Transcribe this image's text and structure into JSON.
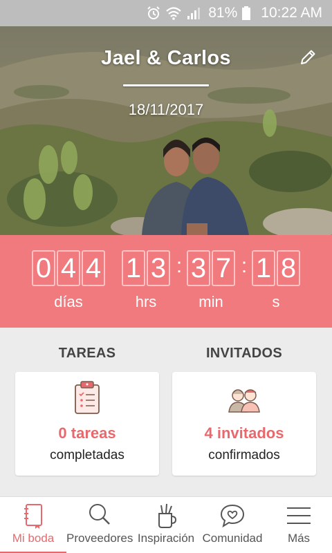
{
  "status_bar": {
    "battery": "81%",
    "time": "10:22 AM",
    "icons": [
      "alarm-icon",
      "wifi-icon",
      "signal-icon",
      "battery-icon"
    ]
  },
  "hero": {
    "title": "Jael & Carlos",
    "date": "18/11/2017",
    "edit_icon": "pencil-icon"
  },
  "countdown": {
    "days": [
      "0",
      "4",
      "4"
    ],
    "hours": [
      "1",
      "3"
    ],
    "minutes": [
      "3",
      "7"
    ],
    "seconds": [
      "1",
      "8"
    ],
    "labels": {
      "days": "días",
      "hours": "hrs",
      "minutes": "min",
      "seconds": "s"
    }
  },
  "sections": {
    "tasks": {
      "heading": "TAREAS",
      "count": "0 tareas",
      "sub": "completadas",
      "icon": "clipboard-icon"
    },
    "guests": {
      "heading": "INVITADOS",
      "count": "4 invitados",
      "sub": "confirmados",
      "icon": "guests-icon"
    }
  },
  "bottom_nav": [
    {
      "label": "Mi boda",
      "icon": "notebook-icon",
      "active": true
    },
    {
      "label": "Proveedores",
      "icon": "search-icon",
      "active": false
    },
    {
      "label": "Inspiración",
      "icon": "inspiration-icon",
      "active": false
    },
    {
      "label": "Comunidad",
      "icon": "chat-heart-icon",
      "active": false
    },
    {
      "label": "Más",
      "icon": "menu-icon",
      "active": false
    }
  ],
  "colors": {
    "accent": "#f17a7e",
    "accent_text": "#e8696d",
    "status_bar": "#bdbdbd"
  }
}
